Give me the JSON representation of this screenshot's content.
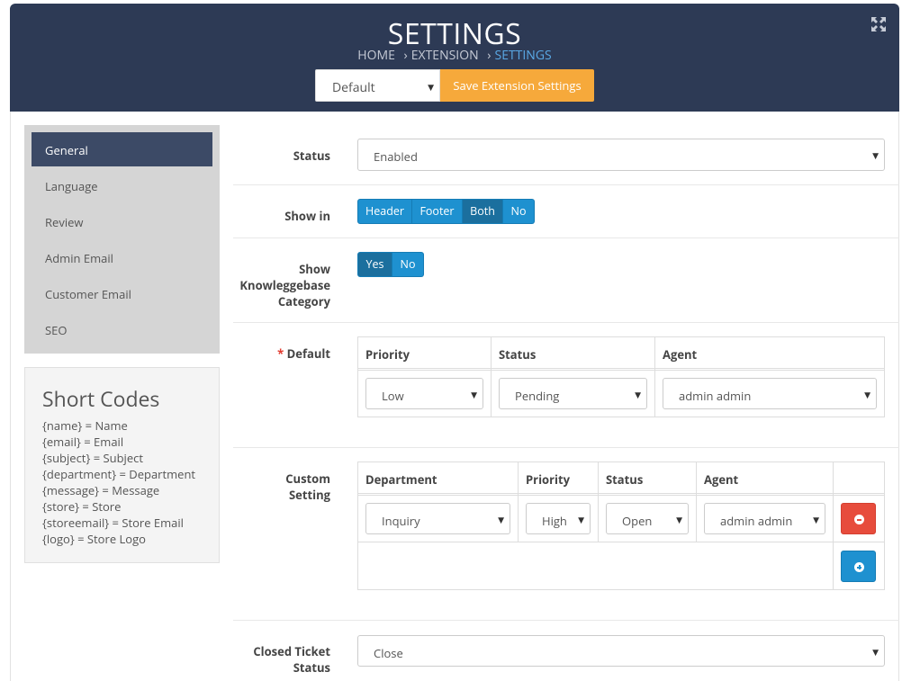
{
  "header": {
    "title": "SETTINGS",
    "breadcrumb": [
      "HOME",
      "EXTENSION",
      "SETTINGS"
    ],
    "breadcrumb_sep": "›",
    "store_select": "Default",
    "save_label": "Save Extension Settings"
  },
  "sidebar": {
    "items": [
      "General",
      "Language",
      "Review",
      "Admin Email",
      "Customer Email",
      "SEO"
    ],
    "active": "General"
  },
  "short_codes": {
    "title": "Short Codes",
    "lines": [
      "{name} = Name",
      "{email} = Email",
      "{subject} = Subject",
      "{department} = Department",
      "{message} = Message",
      "{store} = Store",
      "{storeemail} = Store Email",
      "{logo} = Store Logo"
    ]
  },
  "form": {
    "status": {
      "label": "Status",
      "value": "Enabled"
    },
    "show_in": {
      "label": "Show in",
      "options": [
        "Header",
        "Footer",
        "Both",
        "No"
      ],
      "selected": "Both"
    },
    "show_kb": {
      "label_lines": [
        "Show",
        "Knowleggebase",
        "Category"
      ],
      "options": [
        "Yes",
        "No"
      ],
      "selected": "Yes"
    },
    "default": {
      "required_mark": "*",
      "label": "Default",
      "headers": [
        "Priority",
        "Status",
        "Agent"
      ],
      "priority": "Low",
      "status": "Pending",
      "agent": "admin admin"
    },
    "custom": {
      "label_lines": [
        "Custom",
        "Setting"
      ],
      "headers": [
        "Department",
        "Priority",
        "Status",
        "Agent"
      ],
      "department": "Inquiry",
      "priority": "High",
      "status": "Open",
      "agent": "admin admin"
    },
    "closed": {
      "label_lines": [
        "Closed Ticket",
        "Status"
      ],
      "value": "Close"
    }
  },
  "colors": {
    "header_bg": "#2d3a55",
    "accent_orange": "#f6a93b",
    "toggle_blue": "#1e91d0",
    "danger": "#e74c3c",
    "primary": "#1e91d0"
  }
}
